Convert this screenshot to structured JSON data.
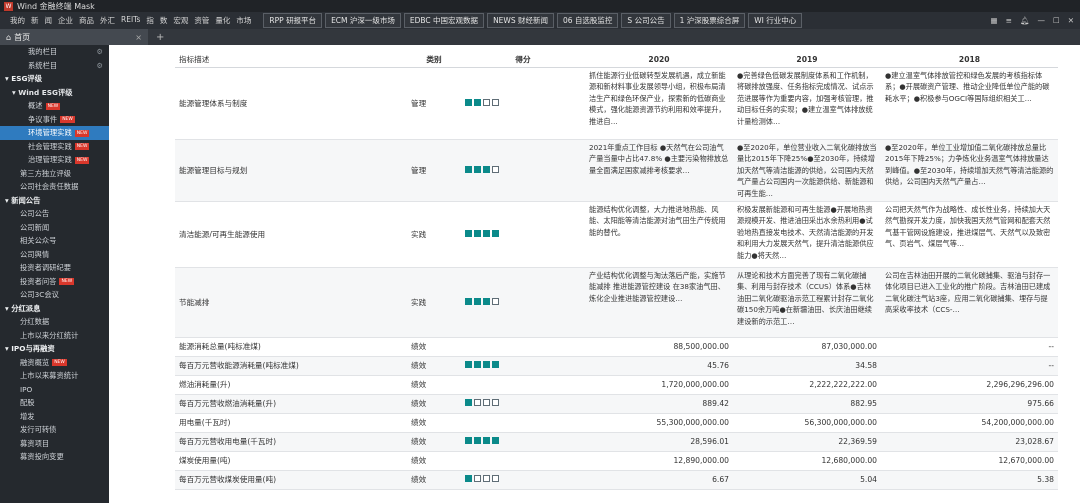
{
  "titlebar": {
    "logo": "W",
    "title": "Wind 金融终端 Mask"
  },
  "topbar": {
    "menu": [
      "我的",
      "新",
      "闻",
      "企业",
      "商品",
      "外汇",
      "REITs",
      "指",
      "数",
      "宏观",
      "资管",
      "量化",
      "市场"
    ],
    "tools": [
      "RPP 研报平台",
      "ECM 沪深一级市场",
      "EDBC 中国宏观数据",
      "NEWS 财经新闻",
      "06 自选股监控",
      "S 公司公告",
      "1 沪深股票综合屏",
      "WI 行业中心"
    ],
    "icons": [
      "grid-icon",
      "menu-icon",
      "bell-icon",
      "minimize-icon",
      "maximize-icon",
      "close-icon"
    ]
  },
  "tabbar": {
    "home_tab": "首页",
    "plus": "+"
  },
  "sidebar": [
    {
      "label": "我的栏目",
      "level": 3,
      "gear": true
    },
    {
      "label": "系统栏目",
      "level": 3,
      "gear": true
    },
    {
      "label": "ESG评级",
      "level": 0
    },
    {
      "label": "Wind ESG评级",
      "level": 1
    },
    {
      "label": "概述",
      "level": 3,
      "new": true
    },
    {
      "label": "争议事件",
      "level": 3,
      "new": true
    },
    {
      "label": "环境管理实践",
      "level": 3,
      "new": true,
      "active": true
    },
    {
      "label": "社会管理实践",
      "level": 3,
      "new": true
    },
    {
      "label": "治理管理实践",
      "level": 3,
      "new": true
    },
    {
      "label": "第三方独立评级",
      "level": 2
    },
    {
      "label": "公司社会责任数据",
      "level": 2
    },
    {
      "label": "新闻公告",
      "level": 0
    },
    {
      "label": "公司公告",
      "level": 2
    },
    {
      "label": "公司新闻",
      "level": 2
    },
    {
      "label": "相关公众号",
      "level": 2
    },
    {
      "label": "公司舆情",
      "level": 2
    },
    {
      "label": "投资者调研纪要",
      "level": 2
    },
    {
      "label": "投资者问答",
      "level": 2,
      "new": true
    },
    {
      "label": "公司3C会议",
      "level": 2
    },
    {
      "label": "分红派息",
      "level": 0
    },
    {
      "label": "分红数据",
      "level": 2
    },
    {
      "label": "上市以来分红统计",
      "level": 2
    },
    {
      "label": "IPO与再融资",
      "level": 0
    },
    {
      "label": "融资概览",
      "level": 2,
      "new": true
    },
    {
      "label": "上市以来募资统计",
      "level": 2
    },
    {
      "label": "IPO",
      "level": 2
    },
    {
      "label": "配股",
      "level": 2
    },
    {
      "label": "增发",
      "level": 2
    },
    {
      "label": "发行可转债",
      "level": 2
    },
    {
      "label": "募资项目",
      "level": 2
    },
    {
      "label": "募资投向变更",
      "level": 2
    }
  ],
  "table": {
    "headers": [
      "指标描述",
      "类别",
      "得分",
      "2020",
      "2019",
      "2018"
    ],
    "rows": [
      {
        "name": "能源管理体系与制度",
        "cat": "管理",
        "score": 2,
        "y2020": "抓住能源行业低碳转型发展机遇，成立新能源和新材料事业发展领导小组，积极布局清洁生产和绿色环保产业，探索新的低碳商业模式，强化能源资源节约利用和效率提升，推进自…",
        "y2019": "●完善绿色低碳发展制度体系和工作机制，将碳排放强度、任务指标完成情况、试点示范进展等作为重要内容，加强考核管理，推动目标任务的实现；●建立温室气体排放统计量检测体…",
        "y2018": "●建立温室气体排放管控和绿色发展的考核指标体系；●开展碳资产管理、推动企业降低单位产能的碳耗水平；●积极参与OGCI等国际组织相关工…",
        "h": 72
      },
      {
        "name": "能源管理目标与规划",
        "cat": "管理",
        "score": 3,
        "y2020": "2021年重点工作目标 ●天然气在公司油气产量当量中占比47.8% ●主要污染物排放总量全面满足国家减排考核要求…",
        "y2019": "●至2020年，单位营业收入二氧化碳排放当量比2015年下降25%●至2030年，持续增加天然气等清洁能源的供给，公司国内天然气产量占公司国内一次能源供给、新能源和可再生能…",
        "y2018": "●至2020年，单位工业增加值二氧化碳排放总量比2015年下降25%；力争炼化业务温室气体排放量达到峰值。●至2030年，持续增加天然气等清洁能源的供给，公司国内天然气产量占…",
        "h": 62
      },
      {
        "name": "清洁能源/可再生能源使用",
        "cat": "实践",
        "score": 4,
        "y2020": "能源结构优化调整，大力推进地热能、风能、太阳能等清洁能源对油气田生产传统用能的替代。",
        "y2019": "积极发展新能源和可再生能源●开展地热资源规模开发、推进油田采出水余热利用●试验地热直接发电技术、天然清洁能源的开发和利用大力发展天然气，提升清洁能源供应能力●将天然…",
        "y2018": "公司把天然气作为战略性、成长性业务，持续加大天然气勘探开发力度，加快我国天然气管网和配套天然气基干管网设施建设，推进煤层气、天然气以及致密气、页岩气、煤层气等…",
        "h": 66
      },
      {
        "name": "节能减排",
        "cat": "实践",
        "score": 3,
        "y2020": "产业结构优化调整与淘汰落后产能，实施节能减排 推进能源管控建设 在38家油气田、炼化企业推进能源管控建设…",
        "y2019": "从理论和技术方面完善了现有二氧化碳捕集、利用与封存技术（CCUS）体系●吉林油田二氧化碳驱油示范工程累计封存二氧化碳150余万吨●在新疆油田、长庆油田继续建设新的示范工…",
        "y2018": "公司在吉林油田开展的二氧化碳捕集、驱油与封存一体化项目已进入工业化的推广阶段。吉林油田已建成二氧化碳注气站3座，应用二氧化碳捕集、埋存与提高采收率技术（CCS-…",
        "h": 70
      },
      {
        "name": "能源消耗总量(吨标准煤)",
        "cat": "绩效",
        "score": null,
        "y2020": "88,500,000.00",
        "y2019": "87,030,000.00",
        "y2018": "--",
        "h": 19,
        "num": true
      },
      {
        "name": "每百万元营收能源消耗量(吨标准煤)",
        "cat": "绩效",
        "score": 4,
        "y2020": "45.76",
        "y2019": "34.58",
        "y2018": "--",
        "h": 19,
        "num": true
      },
      {
        "name": "燃油消耗量(升)",
        "cat": "绩效",
        "score": null,
        "y2020": "1,720,000,000.00",
        "y2019": "2,222,222,222.00",
        "y2018": "2,296,296,296.00",
        "h": 19,
        "num": true
      },
      {
        "name": "每百万元营收燃油消耗量(升)",
        "cat": "绩效",
        "score": 1,
        "y2020": "889.42",
        "y2019": "882.95",
        "y2018": "975.66",
        "h": 19,
        "num": true
      },
      {
        "name": "用电量(千瓦时)",
        "cat": "绩效",
        "score": null,
        "y2020": "55,300,000,000.00",
        "y2019": "56,300,000,000.00",
        "y2018": "54,200,000,000.00",
        "h": 19,
        "num": true
      },
      {
        "name": "每百万元营收用电量(千瓦时)",
        "cat": "绩效",
        "score": 4,
        "y2020": "28,596.01",
        "y2019": "22,369.59",
        "y2018": "23,028.67",
        "h": 19,
        "num": true
      },
      {
        "name": "煤炭使用量(吨)",
        "cat": "绩效",
        "score": null,
        "y2020": "12,890,000.00",
        "y2019": "12,680,000.00",
        "y2018": "12,670,000.00",
        "h": 19,
        "num": true
      },
      {
        "name": "每百万元营收煤炭使用量(吨)",
        "cat": "绩效",
        "score": 1,
        "y2020": "6.67",
        "y2019": "5.04",
        "y2018": "5.38",
        "h": 19,
        "num": true
      }
    ]
  },
  "colors": {
    "score_fill": "#0b8a8a",
    "active_nav": "#2f7bbf",
    "new_badge": "#d9372b",
    "sidebar_bg": "#25292e"
  }
}
